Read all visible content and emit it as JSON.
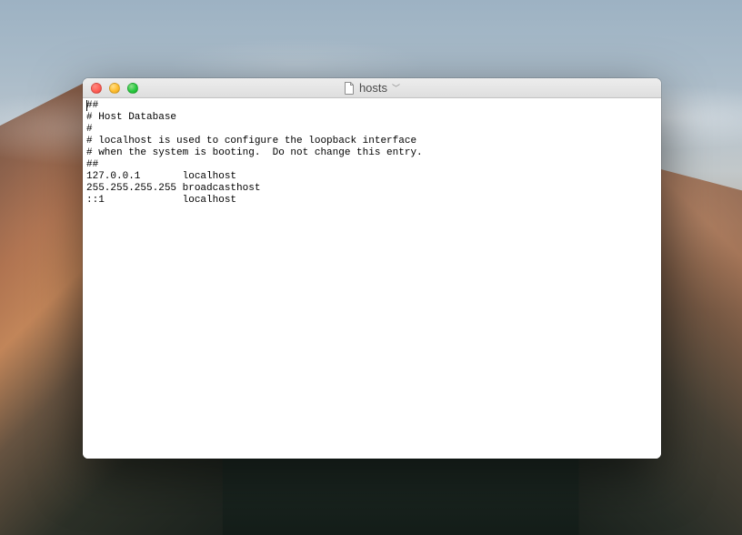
{
  "window": {
    "title": "hosts"
  },
  "document": {
    "lines": [
      "##",
      "# Host Database",
      "#",
      "# localhost is used to configure the loopback interface",
      "# when the system is booting.  Do not change this entry.",
      "##",
      "127.0.0.1       localhost",
      "255.255.255.255 broadcasthost",
      "::1             localhost"
    ]
  }
}
